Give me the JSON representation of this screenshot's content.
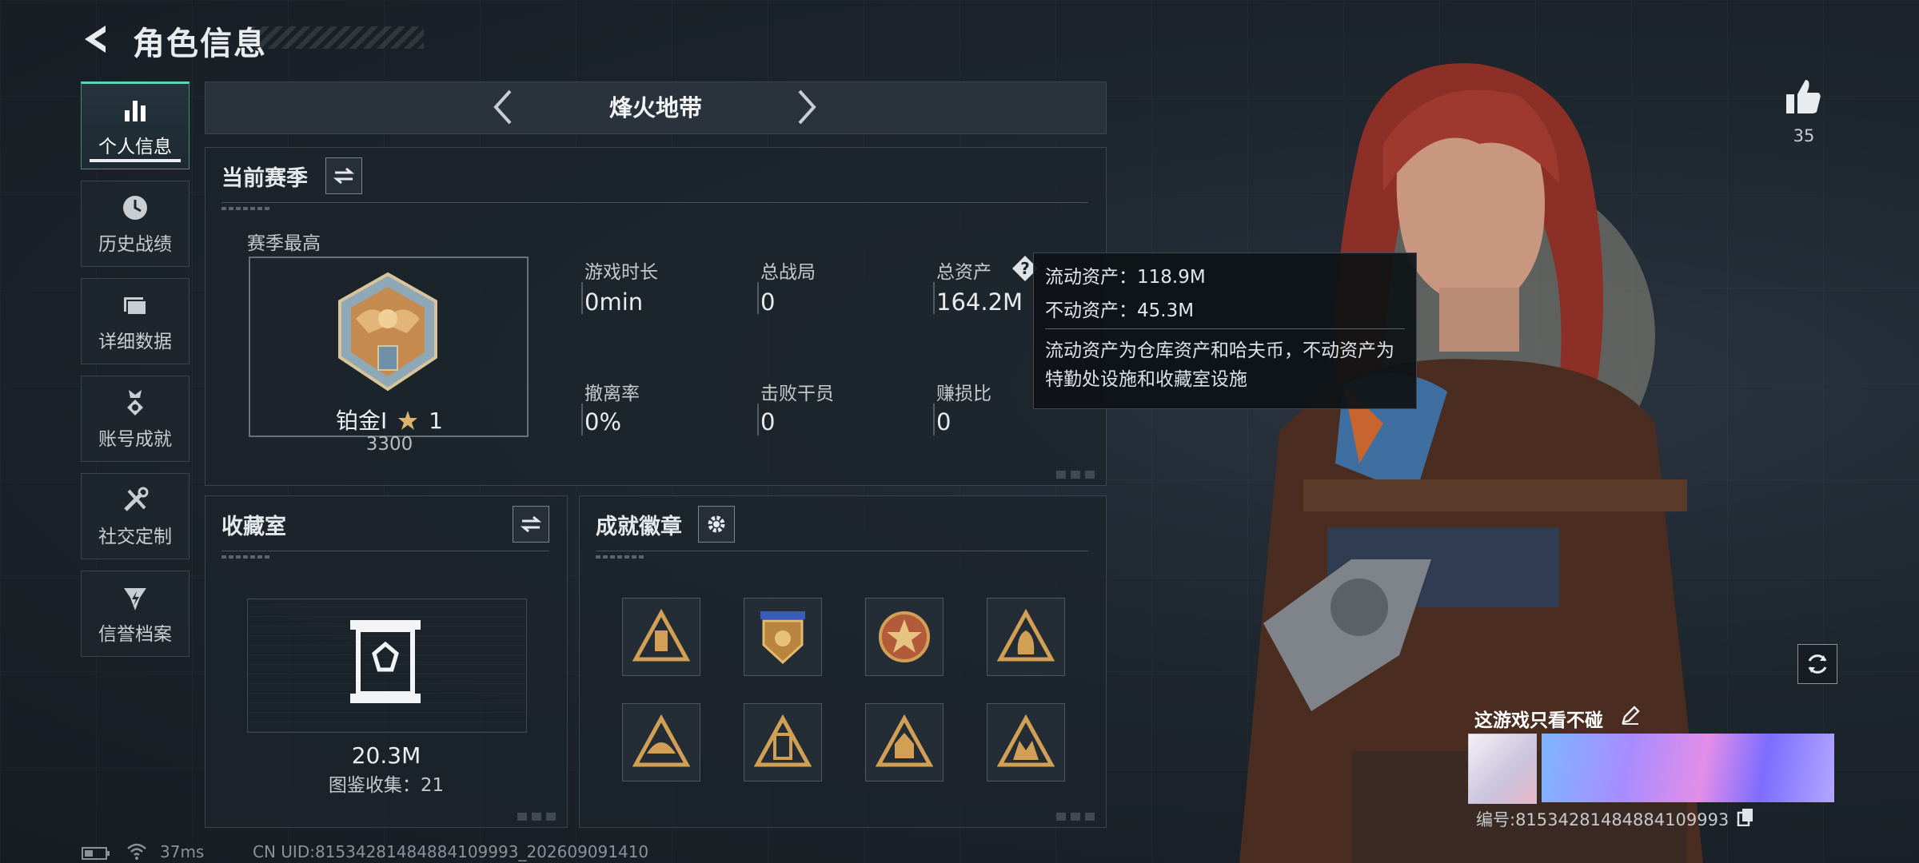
{
  "header": {
    "title": "角色信息"
  },
  "sidebar": {
    "items": [
      {
        "label": "个人信息",
        "icon": "bar-chart-icon",
        "active": true
      },
      {
        "label": "历史战绩",
        "icon": "clock-icon",
        "active": false
      },
      {
        "label": "详细数据",
        "icon": "folder-icon",
        "active": false
      },
      {
        "label": "账号成就",
        "icon": "medal-icon",
        "active": false
      },
      {
        "label": "社交定制",
        "icon": "tools-icon",
        "active": false
      },
      {
        "label": "信誉档案",
        "icon": "shield-icon",
        "active": false
      }
    ]
  },
  "mode": {
    "title": "烽火地带"
  },
  "season": {
    "title": "当前赛季",
    "best_label": "赛季最高",
    "rank_name": "铂金I",
    "rank_stars": "1",
    "rank_score": "3300",
    "stats": [
      {
        "label": "游戏时长",
        "value": "0min"
      },
      {
        "label": "总战局",
        "value": "0"
      },
      {
        "label": "总资产",
        "value": "164.2M"
      },
      {
        "label": "撤离率",
        "value": "0%"
      },
      {
        "label": "击败干员",
        "value": "0"
      },
      {
        "label": "赚损比",
        "value": "0"
      }
    ]
  },
  "tooltip": {
    "liquid": "流动资产：118.9M",
    "fixed": "不动资产：45.3M",
    "description": "流动资产为仓库资产和哈夫币，不动资产为特勤处设施和收藏室设施"
  },
  "collection": {
    "title": "收藏室",
    "value": "20.3M",
    "catalog": "图鉴收集：21"
  },
  "achievements": {
    "title": "成就徽章",
    "badges": [
      "badge-icon",
      "badge-icon",
      "badge-icon",
      "badge-icon",
      "badge-icon",
      "badge-icon",
      "badge-icon",
      "badge-icon"
    ]
  },
  "profile": {
    "likes": "35",
    "name": "这游戏只看不碰",
    "id": "编号:815342814848841099​93"
  },
  "status_bar": {
    "ping": "37ms",
    "uid": "CN UID:8153428148488410999​3_202609091410"
  },
  "colors": {
    "accent": "#5fd6b0",
    "gold": "#d2a055",
    "tooltip_bg": "#0e1216"
  }
}
